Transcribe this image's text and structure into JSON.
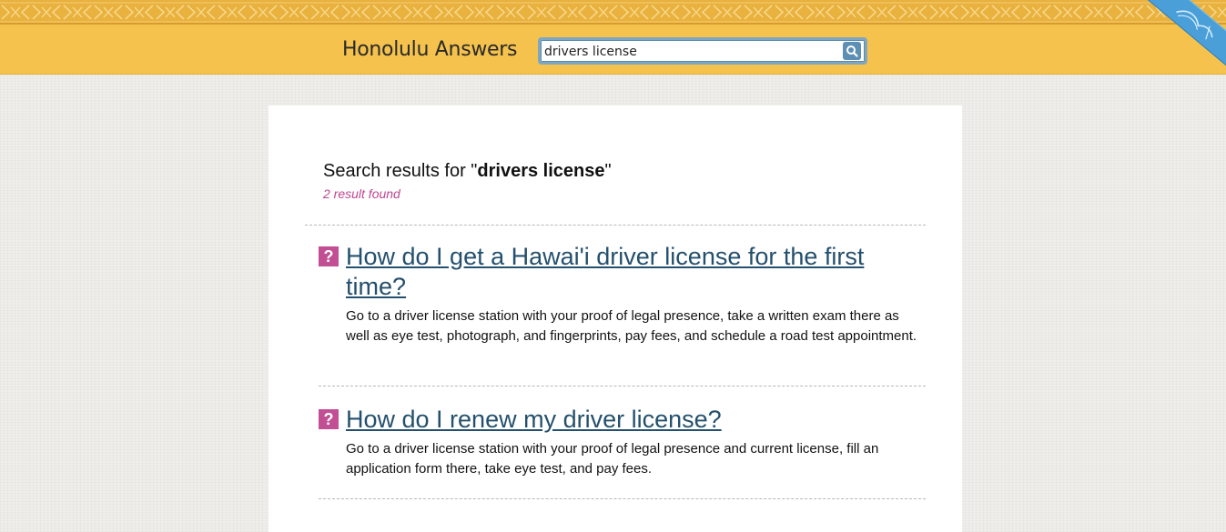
{
  "header": {
    "site_title": "Honolulu Answers",
    "search": {
      "value": "drivers license",
      "placeholder": "",
      "button_icon": "magnifier-icon"
    },
    "ribbon_icon": "ribbon-emblem-icon"
  },
  "results": {
    "heading_prefix": "Search results for \"",
    "query": "drivers license",
    "heading_suffix": "\"",
    "count_text": "2 result found",
    "items": [
      {
        "icon": "?",
        "title": "How do I get a Hawai'i driver license for the first time?",
        "snippet": "Go to a driver license station with your proof of legal presence, take a written exam there as well as eye test, photograph, and fingerprints, pay fees, and schedule a road test appointment."
      },
      {
        "icon": "?",
        "title": "How do I renew my driver license?",
        "snippet": "Go to a driver license station with your proof of legal presence and current license, fill an application form there, take eye test, and pay fees."
      }
    ]
  },
  "colors": {
    "header_bg": "#f5c24d",
    "accent_pink": "#c24f94",
    "link_blue": "#24506d",
    "ribbon_blue": "#4a9fd8"
  }
}
